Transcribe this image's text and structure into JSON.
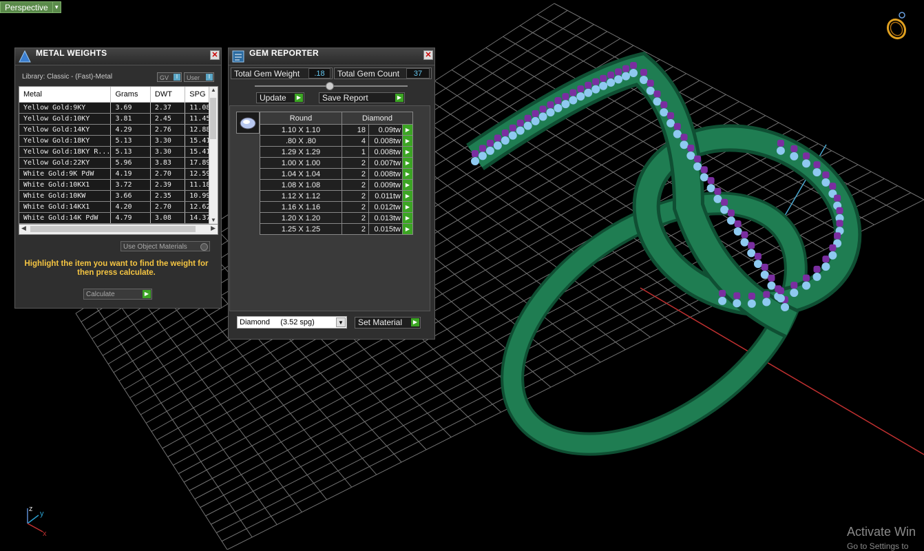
{
  "viewport": {
    "tab_label": "Perspective",
    "watermark_title": "Activate Win",
    "watermark_sub": "Go to Settings to"
  },
  "metal_weights": {
    "title": "METAL WEIGHTS",
    "library": "Library: Classic - (Fast)-Metal",
    "toggle_gv": "GV",
    "toggle_user": "User",
    "columns": [
      "Metal",
      "Grams",
      "DWT",
      "SPG"
    ],
    "rows": [
      [
        "Yellow Gold:9KY",
        "3.69",
        "2.37",
        "11.08"
      ],
      [
        "Yellow Gold:10KY",
        "3.81",
        "2.45",
        "11.45"
      ],
      [
        "Yellow Gold:14KY",
        "4.29",
        "2.76",
        "12.88"
      ],
      [
        "Yellow Gold:18KY",
        "5.13",
        "3.30",
        "15.41"
      ],
      [
        "Yellow Gold:18KY R...",
        "5.13",
        "3.30",
        "15.41"
      ],
      [
        "Yellow Gold:22KY",
        "5.96",
        "3.83",
        "17.89"
      ],
      [
        "White Gold:9K PdW",
        "4.19",
        "2.70",
        "12.59"
      ],
      [
        "White Gold:10KX1",
        "3.72",
        "2.39",
        "11.18"
      ],
      [
        "White Gold:10KW",
        "3.66",
        "2.35",
        "10.99"
      ],
      [
        "White Gold:14KX1",
        "4.20",
        "2.70",
        "12.62"
      ],
      [
        "White Gold:14K PdW",
        "4.79",
        "3.08",
        "14.37"
      ]
    ],
    "use_object_materials": "Use Object Materials",
    "hint": "Highlight the item you want to find the weight for then press calculate.",
    "calculate_label": "Calculate"
  },
  "gem_reporter": {
    "title": "GEM REPORTER",
    "total_weight_label": "Total Gem Weight",
    "total_weight_value": ".18",
    "total_count_label": "Total Gem Count",
    "total_count_value": "37",
    "update_label": "Update",
    "save_report_label": "Save Report",
    "shape_header": "Round",
    "material_header": "Diamond",
    "gems": [
      [
        "1.10 X 1.10",
        "18",
        "0.09tw"
      ],
      [
        ".80 X .80",
        "4",
        "0.008tw"
      ],
      [
        "1.29 X 1.29",
        "1",
        "0.008tw"
      ],
      [
        "1.00 X 1.00",
        "2",
        "0.007tw"
      ],
      [
        "1.04 X 1.04",
        "2",
        "0.008tw"
      ],
      [
        "1.08 X 1.08",
        "2",
        "0.009tw"
      ],
      [
        "1.12 X 1.12",
        "2",
        "0.011tw"
      ],
      [
        "1.16 X 1.16",
        "2",
        "0.012tw"
      ],
      [
        "1.20 X 1.20",
        "2",
        "0.013tw"
      ],
      [
        "1.25 X 1.25",
        "2",
        "0.015tw"
      ]
    ],
    "material_select": "Diamond     (3.52 spg)",
    "set_material_label": "Set Material"
  },
  "axes": {
    "z": "z",
    "y": "y",
    "x": "x"
  },
  "colors": {
    "ring_green": "#1f7d52",
    "gem_purple": "#7a2ea0",
    "gem_blue": "#8ec9f0",
    "grid": "#9a9a9a",
    "hint_yellow": "#f5c542",
    "button_green": "#3ca524"
  }
}
